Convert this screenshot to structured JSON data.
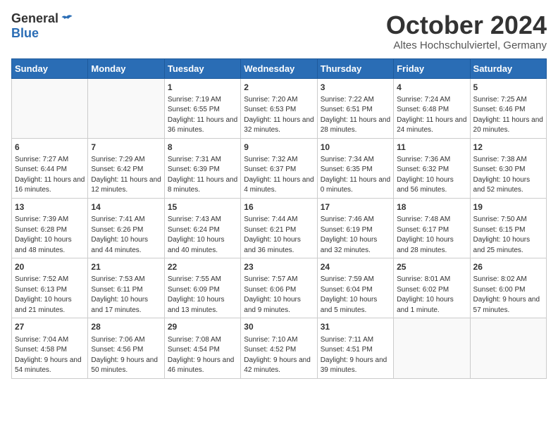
{
  "header": {
    "logo_general": "General",
    "logo_blue": "Blue",
    "month_title": "October 2024",
    "subtitle": "Altes Hochschulviertel, Germany"
  },
  "days_of_week": [
    "Sunday",
    "Monday",
    "Tuesday",
    "Wednesday",
    "Thursday",
    "Friday",
    "Saturday"
  ],
  "weeks": [
    [
      {
        "day": "",
        "info": ""
      },
      {
        "day": "",
        "info": ""
      },
      {
        "day": "1",
        "info": "Sunrise: 7:19 AM\nSunset: 6:55 PM\nDaylight: 11 hours and 36 minutes."
      },
      {
        "day": "2",
        "info": "Sunrise: 7:20 AM\nSunset: 6:53 PM\nDaylight: 11 hours and 32 minutes."
      },
      {
        "day": "3",
        "info": "Sunrise: 7:22 AM\nSunset: 6:51 PM\nDaylight: 11 hours and 28 minutes."
      },
      {
        "day": "4",
        "info": "Sunrise: 7:24 AM\nSunset: 6:48 PM\nDaylight: 11 hours and 24 minutes."
      },
      {
        "day": "5",
        "info": "Sunrise: 7:25 AM\nSunset: 6:46 PM\nDaylight: 11 hours and 20 minutes."
      }
    ],
    [
      {
        "day": "6",
        "info": "Sunrise: 7:27 AM\nSunset: 6:44 PM\nDaylight: 11 hours and 16 minutes."
      },
      {
        "day": "7",
        "info": "Sunrise: 7:29 AM\nSunset: 6:42 PM\nDaylight: 11 hours and 12 minutes."
      },
      {
        "day": "8",
        "info": "Sunrise: 7:31 AM\nSunset: 6:39 PM\nDaylight: 11 hours and 8 minutes."
      },
      {
        "day": "9",
        "info": "Sunrise: 7:32 AM\nSunset: 6:37 PM\nDaylight: 11 hours and 4 minutes."
      },
      {
        "day": "10",
        "info": "Sunrise: 7:34 AM\nSunset: 6:35 PM\nDaylight: 11 hours and 0 minutes."
      },
      {
        "day": "11",
        "info": "Sunrise: 7:36 AM\nSunset: 6:32 PM\nDaylight: 10 hours and 56 minutes."
      },
      {
        "day": "12",
        "info": "Sunrise: 7:38 AM\nSunset: 6:30 PM\nDaylight: 10 hours and 52 minutes."
      }
    ],
    [
      {
        "day": "13",
        "info": "Sunrise: 7:39 AM\nSunset: 6:28 PM\nDaylight: 10 hours and 48 minutes."
      },
      {
        "day": "14",
        "info": "Sunrise: 7:41 AM\nSunset: 6:26 PM\nDaylight: 10 hours and 44 minutes."
      },
      {
        "day": "15",
        "info": "Sunrise: 7:43 AM\nSunset: 6:24 PM\nDaylight: 10 hours and 40 minutes."
      },
      {
        "day": "16",
        "info": "Sunrise: 7:44 AM\nSunset: 6:21 PM\nDaylight: 10 hours and 36 minutes."
      },
      {
        "day": "17",
        "info": "Sunrise: 7:46 AM\nSunset: 6:19 PM\nDaylight: 10 hours and 32 minutes."
      },
      {
        "day": "18",
        "info": "Sunrise: 7:48 AM\nSunset: 6:17 PM\nDaylight: 10 hours and 28 minutes."
      },
      {
        "day": "19",
        "info": "Sunrise: 7:50 AM\nSunset: 6:15 PM\nDaylight: 10 hours and 25 minutes."
      }
    ],
    [
      {
        "day": "20",
        "info": "Sunrise: 7:52 AM\nSunset: 6:13 PM\nDaylight: 10 hours and 21 minutes."
      },
      {
        "day": "21",
        "info": "Sunrise: 7:53 AM\nSunset: 6:11 PM\nDaylight: 10 hours and 17 minutes."
      },
      {
        "day": "22",
        "info": "Sunrise: 7:55 AM\nSunset: 6:09 PM\nDaylight: 10 hours and 13 minutes."
      },
      {
        "day": "23",
        "info": "Sunrise: 7:57 AM\nSunset: 6:06 PM\nDaylight: 10 hours and 9 minutes."
      },
      {
        "day": "24",
        "info": "Sunrise: 7:59 AM\nSunset: 6:04 PM\nDaylight: 10 hours and 5 minutes."
      },
      {
        "day": "25",
        "info": "Sunrise: 8:01 AM\nSunset: 6:02 PM\nDaylight: 10 hours and 1 minute."
      },
      {
        "day": "26",
        "info": "Sunrise: 8:02 AM\nSunset: 6:00 PM\nDaylight: 9 hours and 57 minutes."
      }
    ],
    [
      {
        "day": "27",
        "info": "Sunrise: 7:04 AM\nSunset: 4:58 PM\nDaylight: 9 hours and 54 minutes."
      },
      {
        "day": "28",
        "info": "Sunrise: 7:06 AM\nSunset: 4:56 PM\nDaylight: 9 hours and 50 minutes."
      },
      {
        "day": "29",
        "info": "Sunrise: 7:08 AM\nSunset: 4:54 PM\nDaylight: 9 hours and 46 minutes."
      },
      {
        "day": "30",
        "info": "Sunrise: 7:10 AM\nSunset: 4:52 PM\nDaylight: 9 hours and 42 minutes."
      },
      {
        "day": "31",
        "info": "Sunrise: 7:11 AM\nSunset: 4:51 PM\nDaylight: 9 hours and 39 minutes."
      },
      {
        "day": "",
        "info": ""
      },
      {
        "day": "",
        "info": ""
      }
    ]
  ]
}
